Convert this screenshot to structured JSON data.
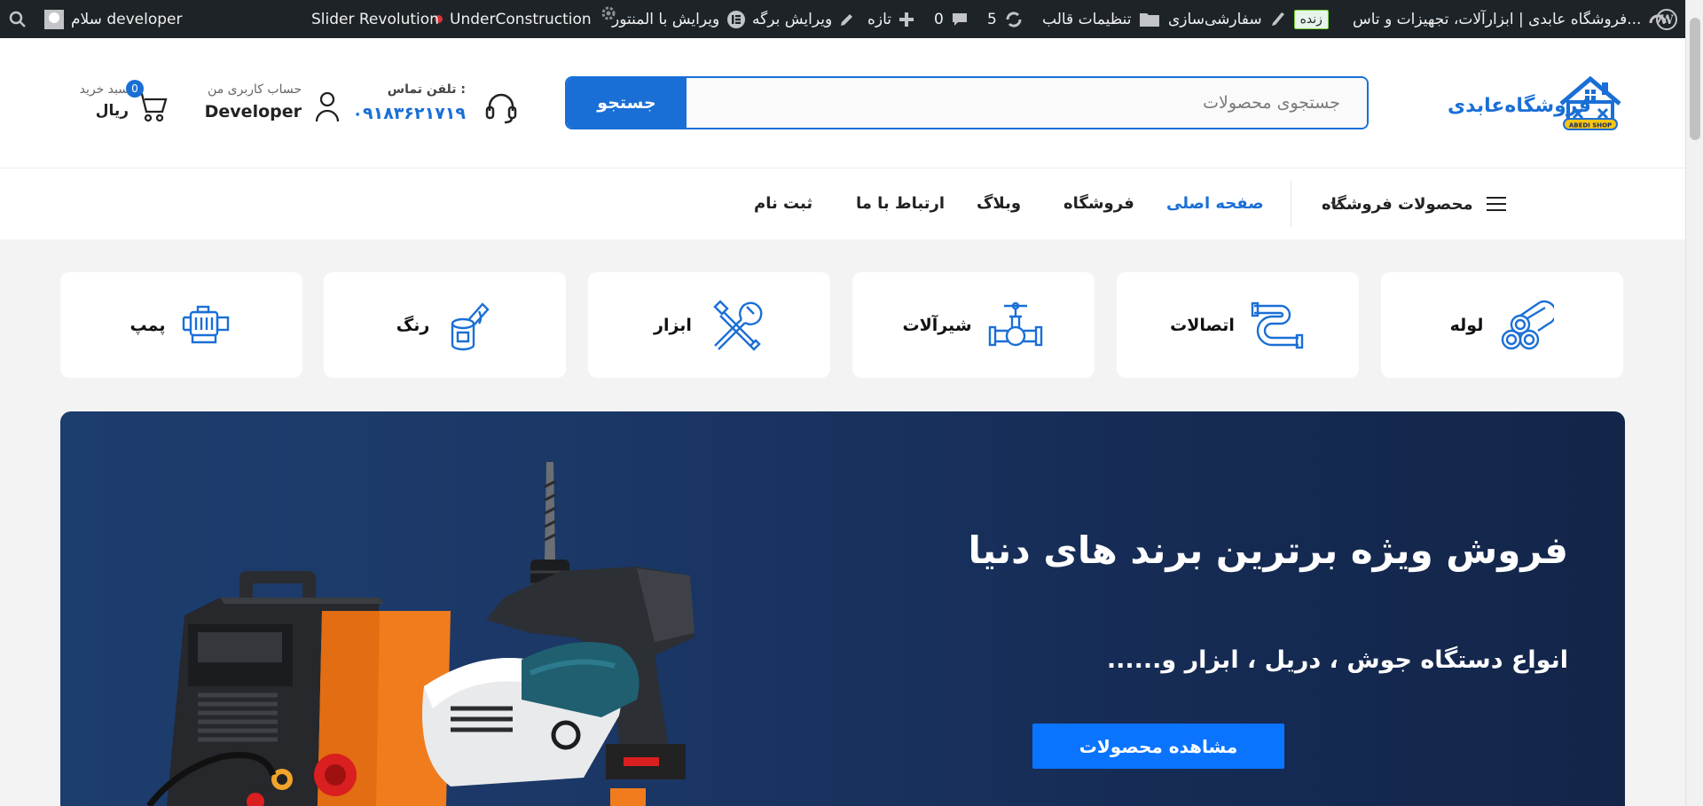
{
  "admin_bar": {
    "site_name": "فروشگاه عابدی | ابزارآلات، تجهیزات و تاس...",
    "live_badge": "زنده",
    "customize": "سفارشی‌سازی",
    "theme_settings": "تنظیمات قالب",
    "updates_count": "5",
    "comments_count": "0",
    "new_label": "تازه",
    "edit_page": "ویرایش برگه",
    "edit_elementor": "ویرایش با المنتور",
    "under_construction": "UnderConstruction",
    "slider_revolution": "Slider Revolution",
    "greeting": "سلام developer"
  },
  "header": {
    "logo_text": "فروشگاه‌عابدی",
    "logo_badge": "ABEDI SHOP",
    "search_placeholder": "جستجوی محصولات",
    "search_button": "جستجو",
    "contact_label": "تلفن تماس :",
    "contact_phone": "۰۹۱۸۳۶۲۱۷۱۹",
    "account_label": "حساب کاربری من",
    "account_name": "Developer",
    "cart_label": "سبد خرید",
    "cart_total": "ریال‌",
    "cart_count": "0"
  },
  "nav": {
    "categories_label": "محصولات فروشگاه",
    "items": [
      "صفحه اصلی",
      "فروشگاه",
      "وبلاگ",
      "ارتباط با ما",
      "ثبت نام"
    ]
  },
  "categories": [
    {
      "label": "لوله",
      "icon": "pipes-icon"
    },
    {
      "label": "اتصالات",
      "icon": "fittings-icon"
    },
    {
      "label": "شیرآلات",
      "icon": "valve-icon"
    },
    {
      "label": "ابزار",
      "icon": "tools-icon"
    },
    {
      "label": "رنگ",
      "icon": "paint-icon"
    },
    {
      "label": "پمپ",
      "icon": "pump-icon"
    }
  ],
  "hero": {
    "title": "فروش ویژه برترین برند های دنیا",
    "subtitle": "انواع دستگاه جوش ، دریل ، ابزار و......",
    "button": "مشاهده محصولات"
  },
  "colors": {
    "brand": "#1a6fd6",
    "admin_bar": "#1d2327",
    "hero_bg": "#1b3766",
    "hero_button": "#0a74ff"
  }
}
